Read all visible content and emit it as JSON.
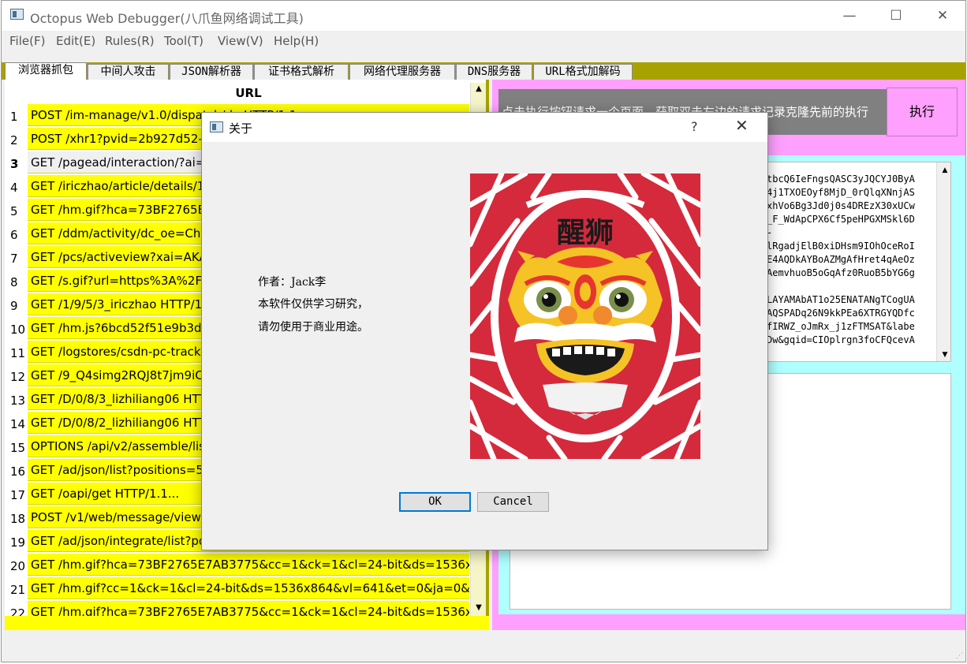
{
  "window": {
    "title": "Octopus Web Debugger(八爪鱼网络调试工具)",
    "minimize": "—",
    "maximize": "☐",
    "close": "✕"
  },
  "menu": [
    "File(F)",
    "Edit(E)",
    "Rules(R)",
    "Tool(T)",
    "View(V)",
    "Help(H)"
  ],
  "tabs": [
    "浏览器抓包",
    "中间人攻击",
    "JSON解析器",
    "证书格式解析",
    "网络代理服务器",
    "DNS服务器",
    "URL格式加解码"
  ],
  "active_tab": "浏览器抓包",
  "request_list": {
    "header": "URL",
    "rows": [
      {
        "num": "1",
        "url": "POST /im-manage/v1.0/dispatch/do HTTP/1.1..."
      },
      {
        "num": "2",
        "url": "POST /xhr1?pvid=2b927d52-e"
      },
      {
        "num": "3",
        "url": "GET /pagead/interaction/?ai=C"
      },
      {
        "num": "4",
        "url": "GET /iriczhao/article/details/12"
      },
      {
        "num": "5",
        "url": "GET /hm.gif?hca=73BF2765E7A"
      },
      {
        "num": "6",
        "url": "GET /ddm/activity/dc_oe=ChM"
      },
      {
        "num": "7",
        "url": "GET /pcs/activeview?xai=AKAO"
      },
      {
        "num": "8",
        "url": "GET /s.gif?url=https%3A%2F%"
      },
      {
        "num": "9",
        "url": "GET /1/9/5/3_iriczhao HTTP/1.1"
      },
      {
        "num": "10",
        "url": "GET /hm.js?6bcd52f51e9b3dce"
      },
      {
        "num": "11",
        "url": "GET /logstores/csdn-pc-trackin"
      },
      {
        "num": "12",
        "url": "GET /9_Q4simg2RQJ8t7jm9iCK"
      },
      {
        "num": "13",
        "url": "GET /D/0/8/3_lizhiliang06 HTTP"
      },
      {
        "num": "14",
        "url": "GET /D/0/8/2_lizhiliang06 HTTP"
      },
      {
        "num": "15",
        "url": "OPTIONS /api/v2/assemble/list"
      },
      {
        "num": "16",
        "url": "GET /ad/json/list?positions=53"
      },
      {
        "num": "17",
        "url": "GET /oapi/get HTTP/1.1..."
      },
      {
        "num": "18",
        "url": "POST /v1/web/message/view/"
      },
      {
        "num": "19",
        "url": "GET /ad/json/integrate/list?pos"
      },
      {
        "num": "20",
        "url": "GET /hm.gif?hca=73BF2765E7AB3775&cc=1&ck=1&cl=24-bit&ds=1536x..."
      },
      {
        "num": "21",
        "url": "GET /hm.gif?cc=1&ck=1&cl=24-bit&ds=1536x864&vl=641&et=0&ja=0&..."
      },
      {
        "num": "22",
        "url": "GET /hm.gif?hca=73BF2765E7AB3775&cc=1&ck=1&cl=24-bit&ds=1536x..."
      }
    ],
    "selected_row": "3"
  },
  "right": {
    "hint": "点击执行按钮请求一个页面，获取双击左边的请求记录克隆先前的执行",
    "execute": "执行",
    "code_lines": [
      "tbcQ6IeFngsQASC3yJQCYJ0ByA",
      "4j1TXOEOyf8MjD_0rQlqXNnjAS",
      "xhVo6Bg3Jd0j0s4DREzX30xUCw",
      "_F_WdApCPX6Cf5peHPGXMSkl6D",
      "-",
      "lRgadjElB0xiDHsm9IOhOceRoI",
      "E4AQDkAYBoAZMgAfHret4qAeOz",
      "AemvhuoB5oGqAfz0RuoB5bYG6g",
      "",
      "LAYAMAbAT1o25ENATANgTCogUA",
      "AQSPADq26N9kkPEa6XTRGYQDfc",
      "fIRWZ_oJmRx_j1zFTMSAT&labe",
      "Dw&gqid=CIOplrgn3foCFQcevA"
    ]
  },
  "dialog": {
    "title": "关于",
    "help": "?",
    "close": "✕",
    "author": "作者：Jack李",
    "line2": "本软件仅供学习研究，",
    "line3": "请勿使用于商业用途。",
    "image_caption": "醒狮",
    "ok": "OK",
    "cancel": "Cancel"
  },
  "colors": {
    "list_bg": "#ffff00",
    "right_bg": "#ffa0ff",
    "cyan": "#b0ffff",
    "tab_strip": "#a8a200",
    "lion_red": "#d42a3c"
  }
}
